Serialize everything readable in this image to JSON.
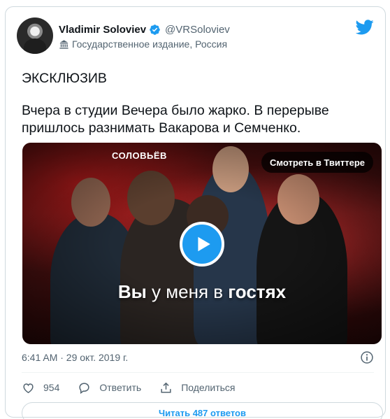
{
  "author": {
    "display_name": "Vladimir Soloviev",
    "handle": "@VRSoloviev",
    "label": "Государственное издание, Россия",
    "avatar_icon": "avatar-photo"
  },
  "tweet": {
    "line1": "ЭКСКЛЮЗИВ",
    "line2": "Вчера в студии Вечера было жарко. В перерыве пришлось разнимать Вакарова и Семченко."
  },
  "media": {
    "show_logo": "СОЛОВЬЁВ",
    "watch_label": "Смотреть в Твиттере",
    "caption_bold1": "Вы",
    "caption_mid": " у меня в ",
    "caption_bold2": "гостях"
  },
  "meta": {
    "timestamp": "6:41 AM · 29 окт. 2019 г."
  },
  "actions": {
    "like_count": "954",
    "reply_label": "Ответить",
    "share_label": "Поделиться"
  },
  "replies_button": "Читать 487 ответов",
  "colors": {
    "accent": "#1d9bf0",
    "text": "#0f1419",
    "muted": "#536471",
    "border": "#cfd9de"
  }
}
